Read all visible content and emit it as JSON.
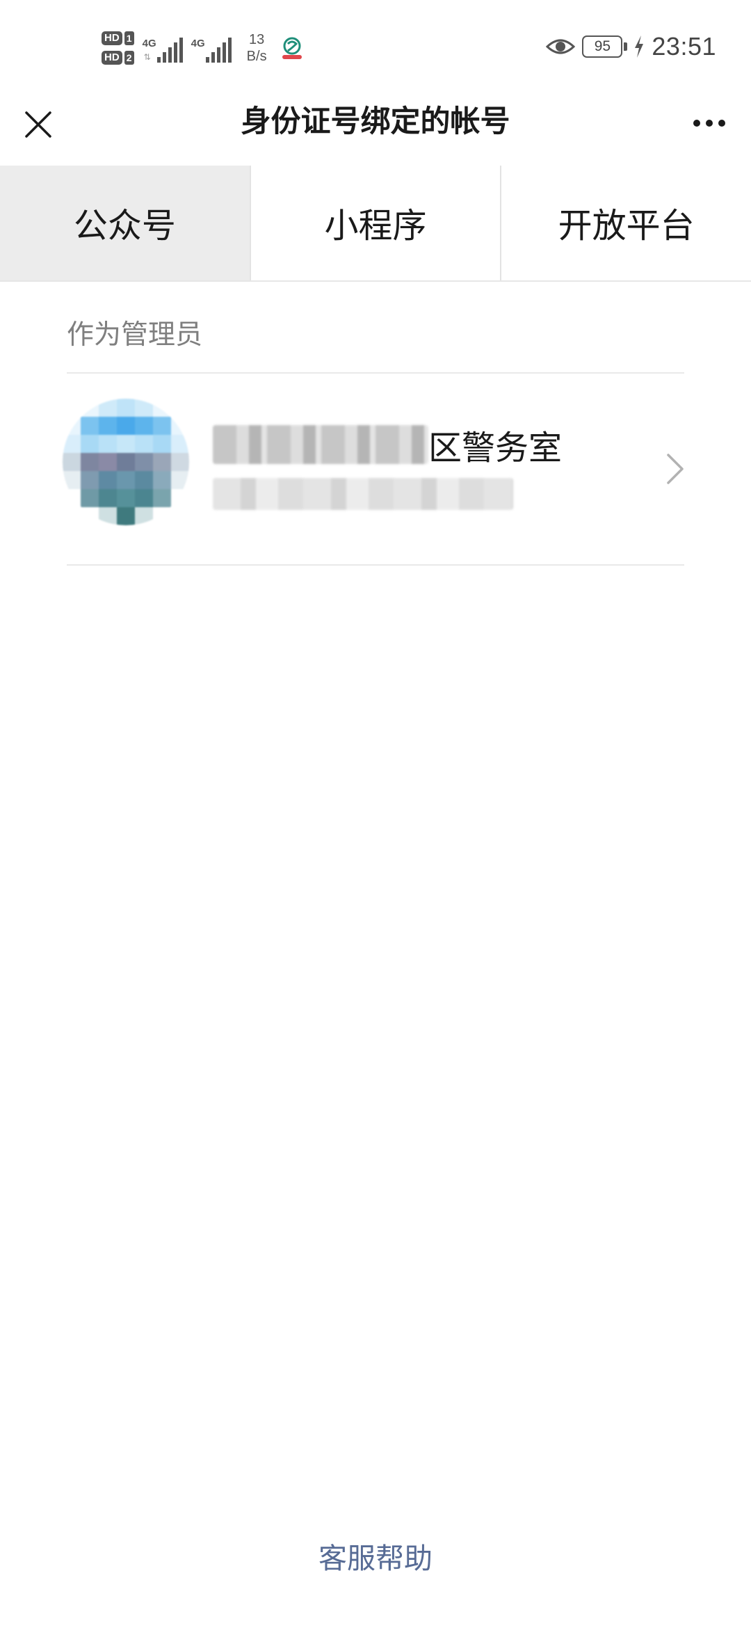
{
  "status_bar": {
    "sim1_badge": "HD",
    "sim1_num": "1",
    "sim2_badge": "HD",
    "sim2_num": "2",
    "signal1_label": "4G",
    "signal2_label": "4G",
    "net_speed_value": "13",
    "net_speed_unit": "B/s",
    "battery_level": "95",
    "time": "23:51",
    "icons": [
      "eye-icon",
      "battery-icon",
      "charging-bolt-icon",
      "carrier-logo-icon"
    ],
    "signal_strength_bars": 5
  },
  "nav": {
    "title": "身份证号绑定的帐号",
    "close_icon": "close-icon",
    "more_icon": "more-icon"
  },
  "tabs": [
    {
      "label": "公众号",
      "active": true
    },
    {
      "label": "小程序",
      "active": false
    },
    {
      "label": "开放平台",
      "active": false
    }
  ],
  "section": {
    "header": "作为管理员"
  },
  "accounts": [
    {
      "name_visible_suffix": "区警务室",
      "name_redacted": true,
      "subtitle_redacted": true,
      "avatar_redacted": true,
      "chevron_icon": "chevron-right-icon"
    }
  ],
  "footer": {
    "help_label": "客服帮助"
  },
  "colors": {
    "link": "#576b95",
    "active_tab_bg": "#ececec",
    "divider": "#e9e9e9",
    "section_header": "#7f7f7f"
  }
}
